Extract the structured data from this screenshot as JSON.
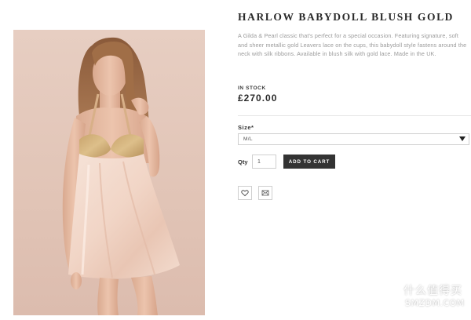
{
  "product": {
    "title": "HARLOW BABYDOLL BLUSH GOLD",
    "description": "A Gilda & Pearl classic that's perfect for a special occasion. Featuring signature, soft and sheer metallic gold Leavers lace on the cups, this babydoll style fastens around the neck with silk ribbons. Available in blush silk with gold lace. Made in the UK.",
    "stock_status": "IN STOCK",
    "price": "£270.00",
    "image": {
      "alt": "Model wearing blush silk babydoll with gold lace cups"
    }
  },
  "size": {
    "label": "Size",
    "required_mark": "*",
    "selected": "M/L"
  },
  "quantity": {
    "label": "Qty",
    "value": "1"
  },
  "actions": {
    "add_to_cart": "ADD TO CART",
    "wishlist_icon": "heart-icon",
    "email_icon": "envelope-icon"
  },
  "watermark": {
    "cn": "什么值得买",
    "en": "SMZDM.COM",
    "logo_char": "值"
  },
  "colors": {
    "button_bg": "#333333",
    "photo_bg": "#e3c8bb",
    "border": "#cfcfcf"
  }
}
